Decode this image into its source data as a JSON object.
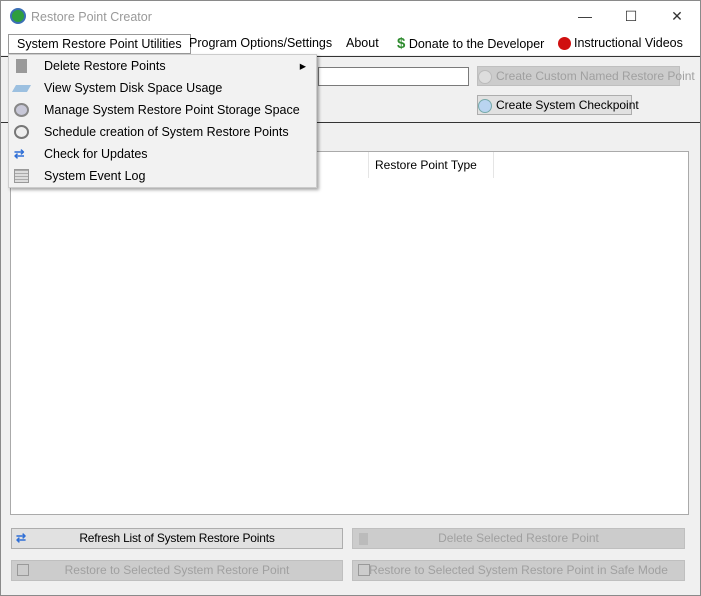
{
  "window": {
    "title": "Restore Point Creator",
    "minimize": "—",
    "maximize": "☐",
    "close": "✕"
  },
  "menu": {
    "items": [
      {
        "label": "System Restore Point Utilities",
        "icon": ""
      },
      {
        "label": "Program Options/Settings",
        "icon": ""
      },
      {
        "label": "About",
        "icon": ""
      },
      {
        "label": "Donate to the Developer",
        "icon": "dollar-icon"
      },
      {
        "label": "Instructional Videos",
        "icon": "video-play-icon"
      }
    ]
  },
  "dropdown": {
    "items": [
      {
        "label": "Delete Restore Points",
        "icon": "trash-icon",
        "submenu": true
      },
      {
        "label": "View System Disk Space Usage",
        "icon": "disk-icon"
      },
      {
        "label": "Manage System Restore Point Storage Space",
        "icon": "storage-gear-icon"
      },
      {
        "label": "Schedule creation of System Restore Points",
        "icon": "clock-icon"
      },
      {
        "label": "Check for Updates",
        "icon": "refresh-icon"
      },
      {
        "label": "System Event Log",
        "icon": "log-icon"
      }
    ],
    "submenu_arrow": "▸"
  },
  "toolbar": {
    "name_input_value": "",
    "create_custom_label": "Create Custom Named Restore Point",
    "create_checkpoint_label": "Create System Checkpoint"
  },
  "list": {
    "columns": [
      "",
      "Restore Point Type"
    ],
    "rows": []
  },
  "buttons": {
    "refresh": "Refresh List of System Restore Points",
    "delete": "Delete Selected Restore Point",
    "restore": "Restore to Selected System Restore Point",
    "restore_safe": "Restore to Selected System Restore Point in Safe Mode"
  },
  "colors": {
    "donate_green": "#2e8b2e",
    "video_red": "#d01010",
    "refresh_blue": "#2f6fd6",
    "disabled_text": "#a0a0a0"
  }
}
